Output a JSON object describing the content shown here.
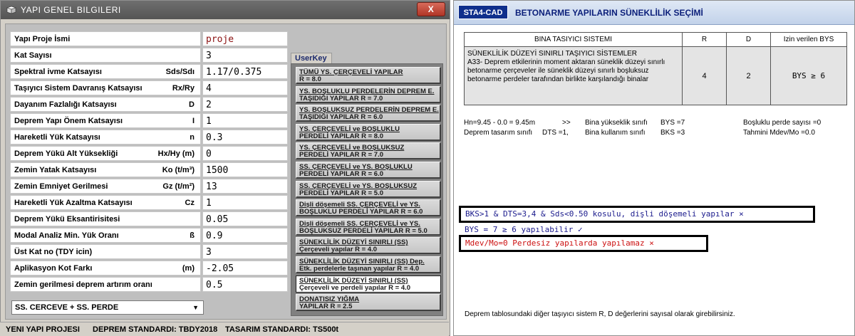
{
  "left_window": {
    "title": "YAPI GENEL BILGILERI",
    "close_label": "X",
    "fields": [
      {
        "label": "Yapı Proje İsmi",
        "unit": "",
        "value": "proje"
      },
      {
        "label": "Kat Sayısı",
        "unit": "",
        "value": "3"
      },
      {
        "label": "Spektral ivme Katsayısı",
        "unit": "Sds/Sdı",
        "value": "1.17/0.375"
      },
      {
        "label": "Taşıyıcı Sistem Davranış Katsayısı",
        "unit": "Rx/Ry",
        "value": "4"
      },
      {
        "label": "Dayanım Fazlalığı Katsayısı",
        "unit": "D",
        "value": "2"
      },
      {
        "label": "Deprem Yapı Önem Katsayısı",
        "unit": "I",
        "value": "1"
      },
      {
        "label": "Hareketli Yük Katsayısı",
        "unit": "n",
        "value": "0.3"
      },
      {
        "label": "Deprem Yükü Alt Yüksekliği",
        "unit": "Hx/Hy  (m)",
        "value": "0"
      },
      {
        "label": "Zemin Yatak Katsayısı",
        "unit": "Ko  (t/m³)",
        "value": "1500"
      },
      {
        "label": "Zemin Emniyet Gerilmesi",
        "unit": "Gz  (t/m²)",
        "value": "13"
      },
      {
        "label": "Hareketli Yük Azaltma Katsayısı",
        "unit": "Cz",
        "value": "1"
      },
      {
        "label": "Deprem Yükü Eksantirisitesi",
        "unit": "",
        "value": "0.05"
      },
      {
        "label": "Modal Analiz Min. Yük Oranı",
        "unit": "ß",
        "value": "0.9"
      },
      {
        "label": "Üst Kat no (TDY icin)",
        "unit": "",
        "value": "3"
      },
      {
        "label": "Aplikasyon Kot Farkı",
        "unit": "(m)",
        "value": "-2.05"
      },
      {
        "label": "Zemin gerilmesi deprem artırım oranı",
        "unit": "",
        "value": "0.5"
      }
    ],
    "dropdown": {
      "selected": "SS. CERCEVE + SS. PERDE"
    },
    "userkey": {
      "tab_label": "UserKey",
      "buttons": [
        {
          "line1": "TÜMÜ YS. ÇERÇEVELİ YAPILAR",
          "line2": "R = 8.0"
        },
        {
          "line1": "YS. BOŞLUKLU PERDELERİN DEPREM E.",
          "line2": "TAŞIDIĞI YAPILAR     R = 7.0"
        },
        {
          "line1": "YS. BOŞLUKSUZ PERDELERİN DEPREM E.",
          "line2": "TAŞIDIĞI YAPILAR     R = 6.0"
        },
        {
          "line1": "YS. ÇERÇEVELİ ve BOŞLUKLU",
          "line2": "PERDELİ YAPILAR  R = 8.0"
        },
        {
          "line1": "YS. ÇERÇEVELİ ve BOŞLUKSUZ",
          "line2": "PERDELİ YAPILAR  R = 7.0"
        },
        {
          "line1": "SS. ÇERÇEVELİ ve YS. BOŞLUKLU",
          "line2": "PERDELİ YAPILAR  R = 6.0"
        },
        {
          "line1": "SS. ÇERÇEVELİ ve YS. BOŞLUKSUZ",
          "line2": "PERDELİ YAPILAR  R = 5.0"
        },
        {
          "line1": "Dişli döşemeli SS. ÇERÇEVELİ ve YS.",
          "line2": "BOŞLUKLU PERDELİ YAPILAR  R = 6.0"
        },
        {
          "line1": "Dişli döşemeli SS. ÇERÇEVELİ ve YS.",
          "line2": "BOŞLUKSUZ PERDELİ YAPILAR R = 5.0"
        },
        {
          "line1": "SÜNEKLİLİK DÜZEYİ SINIRLI (SS)",
          "line2": "Çerçeveli yapılar R = 4.0"
        },
        {
          "line1": "SÜNEKLİLİK DÜZEYİ SINIRLI (SS) Dep.",
          "line2": "Etk. perdelerle taşınan yapılar R = 4.0"
        },
        {
          "line1": "SÜNEKLİLİK DÜZEYİ SINIRLI (SS)",
          "line2": "Çerçeveli ve perdeli yapılar R = 4.0"
        },
        {
          "line1": "DONATISIZ YIĞMA",
          "line2": "YAPILAR  R = 2.5"
        }
      ]
    },
    "statusbar": {
      "project": "YENI YAPI PROJESI",
      "deprem": "DEPREM STANDARDI: TBDY2018",
      "tasarim": "TASARIM STANDARDI: TS500t"
    }
  },
  "right_window": {
    "logo": "STA4-CAD",
    "title": "BETONARME YAPILARIN SÜNEKLİLİK SEÇİMİ",
    "table": {
      "headers": [
        "BINA TASIYICI SISTEMI",
        "R",
        "D",
        "Izin verilen BYS"
      ],
      "row": {
        "desc_title": "SÜNEKLİLİK DÜZEYİ SINIRLI TAŞIYICI SİSTEMLER",
        "desc_body": "A33- Deprem etkilerinin moment aktaran süneklik düzeyi sınırlı betonarme çerçeveler ile süneklik düzeyi sınırlı boşluksuz betonarme perdeler tarafından birlikte karşılandığı binalar",
        "R": "4",
        "D": "2",
        "bys": "BYS  ≥  6"
      }
    },
    "info": {
      "hn": "Hn=9.45 - 0.0 = 9.45m",
      "arrow": ">>",
      "bys_label": "Bina yükseklik sınıfı",
      "bys_value": "BYS =7",
      "bosluklu": "Boşluklu perde sayısı =0",
      "dts_label": "Deprem tasarım sınıfı",
      "dts_value": "DTS =1,",
      "bks_label": "Bina kullanım  sınıfı",
      "bks_value": "BKS =3",
      "mdev": "Tahmini  Mdev/Mo =0.0"
    },
    "messages": {
      "m1": "BKS>1 & DTS=3,4 & Sds<0.50 kosulu, dişli döşemeli yapılar ×",
      "m2": "BYS = 7 ≥ 6 yapılabilir  ✓",
      "m3": "Mdev/Mo=0 Perdesiz yapılarda yapılamaz ×"
    },
    "footnote": "Deprem tablosundaki diğer taşıyıcı sistem R, D değerlerini sayısal olarak girebilirsiniz."
  }
}
